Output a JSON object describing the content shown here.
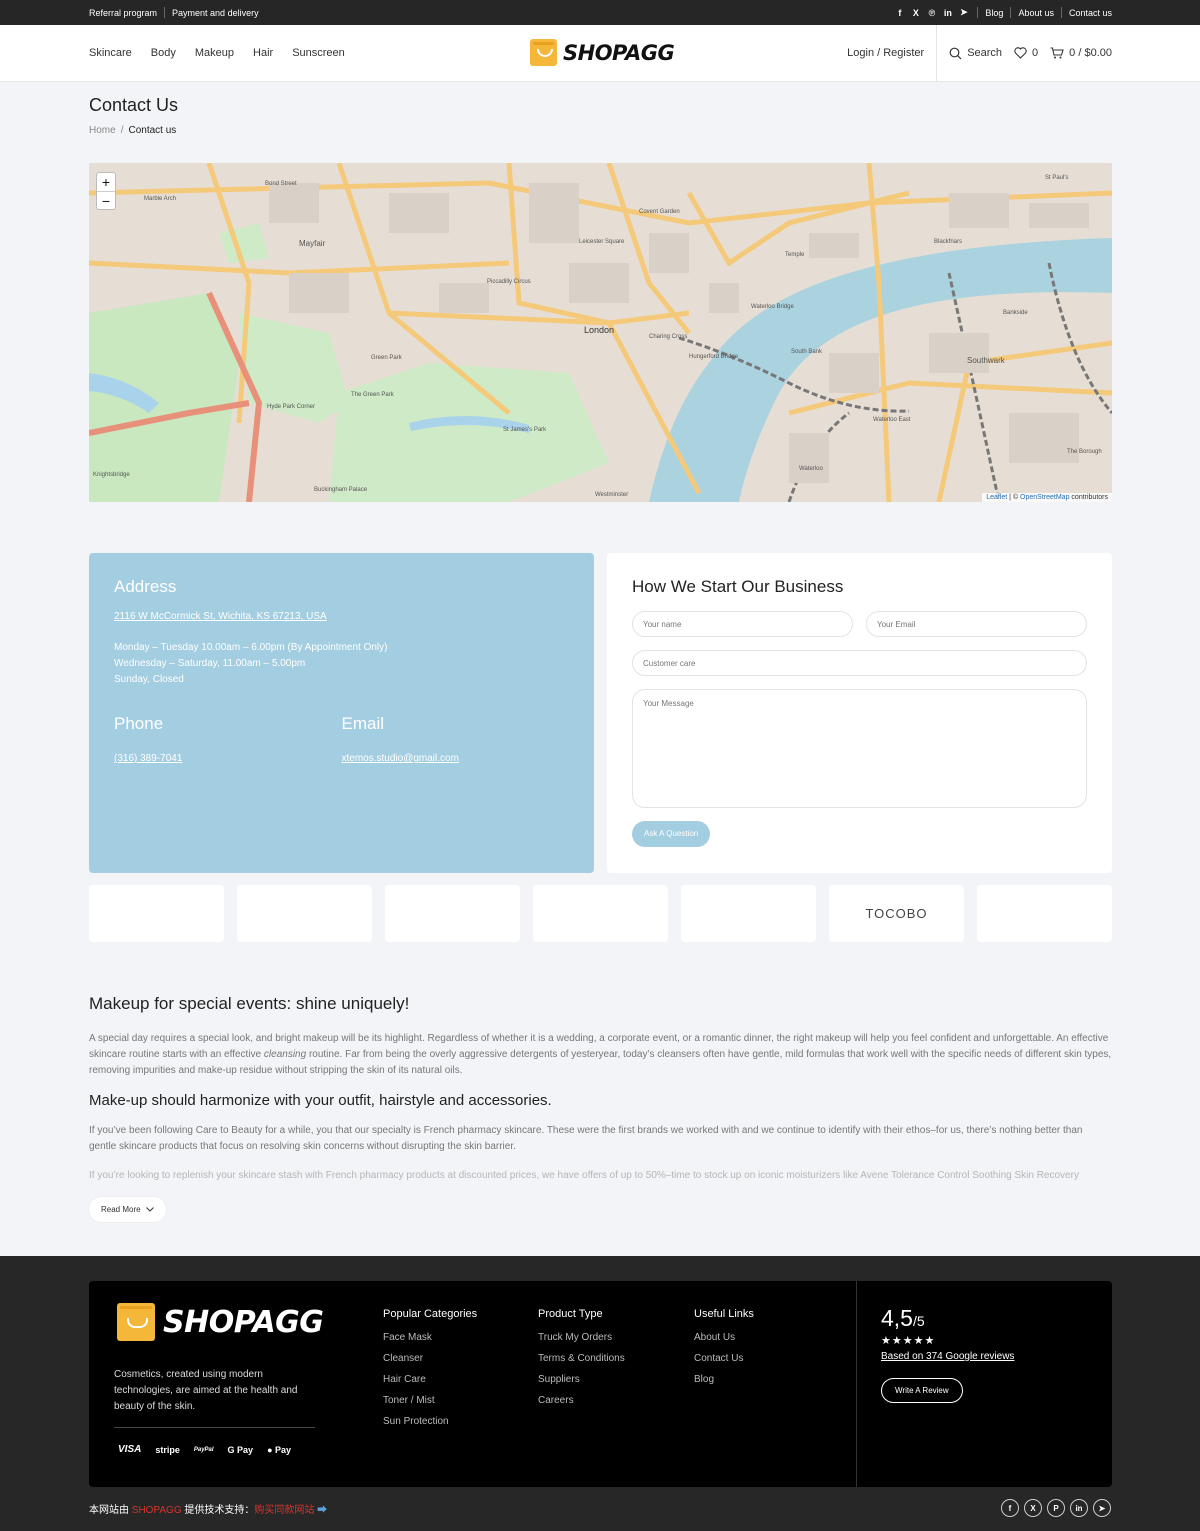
{
  "topbar": {
    "left_links": [
      "Referral program",
      "Payment and delivery"
    ],
    "social_icons": [
      "facebook-icon",
      "x-icon",
      "pinterest-icon",
      "linkedin-icon",
      "telegram-icon"
    ],
    "right_links": [
      "Blog",
      "About us",
      "Contact us"
    ]
  },
  "header": {
    "nav": [
      "Skincare",
      "Body",
      "Makeup",
      "Hair",
      "Sunscreen"
    ],
    "logo_text": "SHOPAGG",
    "login": "Login / Register",
    "search": "Search",
    "wishlist_count": "0",
    "cart": "0 / $0.00"
  },
  "page": {
    "title": "Contact Us",
    "breadcrumb": [
      "Home",
      "Contact us"
    ]
  },
  "map": {
    "zoom_in": "+",
    "zoom_out": "−",
    "attribution_leaflet": "Leaflet",
    "attribution_osm": "OpenStreetMap",
    "attribution_rest": "contributors",
    "labels": [
      "Bond Street",
      "Mayfair",
      "Piccadilly Circus",
      "London",
      "Leicester Square",
      "Covent Garden",
      "Waterloo Bridge",
      "Charing Cross",
      "Hungerford Bridge",
      "South Bank",
      "Southwark",
      "Blackfriars",
      "Green Park",
      "St James's Park",
      "Hyde Park Corner",
      "Buckingham Palace",
      "Knightsbridge",
      "Marble Arch",
      "Westminster",
      "Waterloo",
      "The Green Park",
      "Waterloo East",
      "The Borough",
      "St Paul's",
      "Bankside",
      "Temple"
    ]
  },
  "contact": {
    "address_title": "Address",
    "address": "2116 W McCormick St, Wichita, KS 67213, USA",
    "hours": [
      "Monday – Tuesday 10.00am – 6.00pm (By Appointment Only)",
      "Wednesday – Saturday, 11.00am – 5.00pm",
      "Sunday, Closed"
    ],
    "phone_title": "Phone",
    "phone": "(316) 389-7041",
    "email_title": "Email",
    "email": "xtemos.studio@gmail.com"
  },
  "form": {
    "title": "How We Start Our Business",
    "name_placeholder": "Your name",
    "email_placeholder": "Your Email",
    "care_placeholder": "Customer care",
    "message_placeholder": "Your Message",
    "submit": "Ask A Question"
  },
  "brands": [
    "",
    "",
    "",
    "",
    "",
    "TOCOBO",
    ""
  ],
  "article": {
    "h1": "Makeup for special events: shine uniquely!",
    "p1_a": "A special day requires a special look, and bright makeup will be its highlight. Regardless of whether it is a wedding, a corporate event, or a romantic dinner, the right makeup will help you feel confident and unforgettable. An effective skincare routine starts with an effective ",
    "p1_em": "cleansing",
    "p1_b": " routine. Far from being the overly aggressive detergents of yesteryear, today’s cleansers often have gentle, mild formulas that work well with the specific needs of different skin types, removing impurities and make-up residue without stripping the skin of its natural oils.",
    "h2": "Make-up should harmonize with your outfit, hairstyle and accessories.",
    "p2": "If you’ve been following Care to Beauty for a while, you that our specialty is French pharmacy skincare. These were the first brands we worked with and we continue to identify with their ethos–for us, there’s nothing better than gentle skincare products that focus on resolving skin concerns without disrupting the skin barrier.",
    "p3": "If you’re looking to replenish your skincare stash with French pharmacy products at discounted prices, we have offers of up to 50%–time to stock up on iconic moisturizers like Avene Tolerance Control Soothing Skin Recovery",
    "read_more": "Read More"
  },
  "footer": {
    "logo_text": "SHOPAGG",
    "description": "Cosmetics, created using modern technologies, are aimed at the health and beauty of the skin.",
    "payments": [
      "VISA",
      "stripe",
      "PayPal",
      "G Pay",
      "Pay"
    ],
    "col1_title": "Popular Categories",
    "col1": [
      "Face Mask",
      "Cleanser",
      "Hair Care",
      "Toner / Mist",
      "Sun Protection"
    ],
    "col2_title": "Product Type",
    "col2": [
      "Truck My Orders",
      "Terms & Conditions",
      "Suppliers",
      "Careers"
    ],
    "col3_title": "Useful Links",
    "col3": [
      "About Us",
      "Contact Us",
      "Blog"
    ],
    "rating": "4,5",
    "rating_max": "/5",
    "stars": "★★★★★",
    "reviews_link": "Based on 374 Google reviews",
    "write_review": "Write A Review",
    "bottom_a": "本网站由 ",
    "bottom_brand": "SHOPAGG",
    "bottom_b": " 提供技术支持：",
    "bottom_link": "购买同款网站",
    "bottom_arrow": "➡",
    "social": [
      "f",
      "X",
      "P",
      "in",
      "➤"
    ]
  },
  "colors": {
    "accent_blue": "#a3cde0",
    "logo_orange": "#f4b73a",
    "footer_bg": "#272727",
    "red": "#d9342b"
  }
}
